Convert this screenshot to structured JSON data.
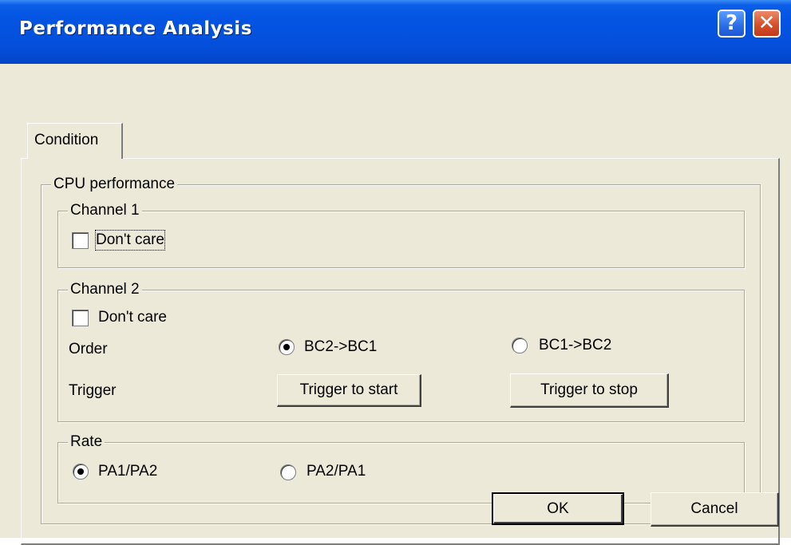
{
  "window": {
    "title": "Performance Analysis",
    "help_label": "?",
    "close_label": "✕"
  },
  "tabs": [
    {
      "label": "Condition",
      "active": true
    }
  ],
  "cpu_group": {
    "legend": "CPU performance",
    "channel1": {
      "legend": "Channel 1",
      "dont_care_label": "Don't care",
      "dont_care_checked": false
    },
    "channel2": {
      "legend": "Channel 2",
      "dont_care_label": "Don't care",
      "dont_care_checked": false,
      "order_label": "Order",
      "order_options": [
        {
          "label": "BC2->BC1",
          "checked": true
        },
        {
          "label": "BC1->BC2",
          "checked": false
        }
      ],
      "trigger_label": "Trigger",
      "trigger_start_label": "Trigger to start",
      "trigger_stop_label": "Trigger to stop"
    },
    "rate": {
      "legend": "Rate",
      "options": [
        {
          "label": "PA1/PA2",
          "checked": true
        },
        {
          "label": "PA2/PA1",
          "checked": false
        }
      ]
    }
  },
  "footer": {
    "ok_label": "OK",
    "cancel_label": "Cancel"
  },
  "colors": {
    "titlebar": "#0454e2",
    "face": "#ece9d8",
    "close_button": "#d8502a"
  }
}
